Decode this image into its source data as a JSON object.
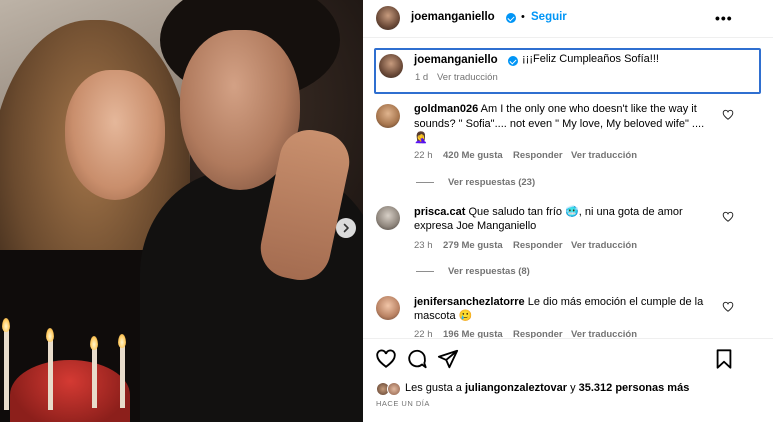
{
  "header": {
    "username": "joemanganiello",
    "separator": "•",
    "follow_label": "Seguir",
    "more_label": "•••"
  },
  "caption": {
    "username": "joemanganiello",
    "text": "¡¡¡Feliz Cumpleaños Sofía!!!",
    "time": "1 d",
    "translate_label": "Ver traducción"
  },
  "comments": [
    {
      "username": "goldman026",
      "text_line1": "Am I the only one who doesn't like the way it",
      "text_line2": "sounds? \" Sofia\".... not even \" My love, My beloved wife\" ....",
      "text_line3": "🤦‍♀️",
      "time": "22 h",
      "likes": "420 Me gusta",
      "reply_label": "Responder",
      "translate_label": "Ver traducción",
      "view_replies": "Ver respuestas (23)"
    },
    {
      "username": "prisca.cat",
      "text_line1": "Que saludo tan frío 🥶, ni una gota de amor",
      "text_line2": "expresa Joe Manganiello",
      "time": "23 h",
      "likes": "279 Me gusta",
      "reply_label": "Responder",
      "translate_label": "Ver traducción",
      "view_replies": "Ver respuestas (8)"
    },
    {
      "username": "jenifersanchezlatorre",
      "text_line1": "Le dio más emoción el cumple de la",
      "text_line2": "mascota 🥲",
      "time": "22 h",
      "likes": "196 Me gusta",
      "reply_label": "Responder",
      "translate_label": "Ver traducción"
    }
  ],
  "likes_bar": {
    "prefix": "Les gusta a ",
    "user": "juliangonzaleztovar",
    "middle": " y ",
    "others": "35.312 personas más"
  },
  "timestamp": "HACE UN DÍA",
  "icons": {
    "like": "heart-icon",
    "comment": "comment-icon",
    "share": "share-icon",
    "save": "bookmark-icon",
    "next": "chevron-right-icon",
    "comment_like": "heart-icon"
  },
  "colors": {
    "accent": "#0095f6",
    "focus_border": "#2f6fd0",
    "secondary_text": "#737373"
  }
}
